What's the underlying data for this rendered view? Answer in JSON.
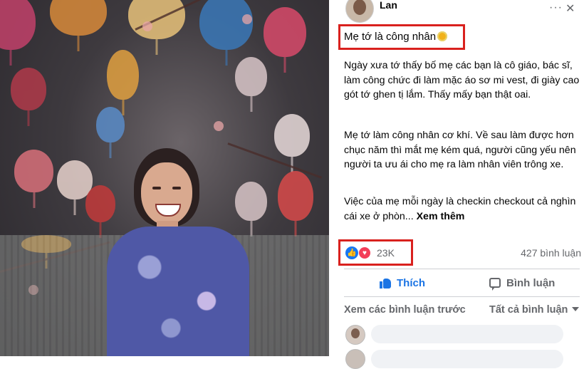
{
  "post": {
    "author": "Lan",
    "more_glyph": "···",
    "close_glyph": "✕",
    "title": "Mẹ tớ là công nhân",
    "paragraph_1": "Ngày xưa tớ thấy bố mẹ các bạn là cô giáo, bác sĩ, làm công chức đi làm mặc áo sơ mi vest, đi giày cao gót tớ ghen tị lắm. Thấy mấy bạn thật oai.",
    "paragraph_2": "Mẹ tớ làm công nhân cơ khí. Về sau làm được hơn chục năm thì mắt mẹ kém quá, người cũng yếu nên người ta ưu ái cho mẹ ra làm nhân viên trông xe.",
    "paragraph_3": "Việc của mẹ mỗi ngày là checkin checkout cả nghìn cái xe ở phòn...",
    "see_more": "Xem thêm"
  },
  "reactions": {
    "count": "23K",
    "comments": "427 bình luận"
  },
  "actions": {
    "like": "Thích",
    "comment": "Bình luận"
  },
  "comments": {
    "view_previous": "Xem các bình luận trước",
    "filter": "Tất cả bình luận"
  },
  "colors": {
    "highlight_box": "#d9211e",
    "like_blue": "#1b74e4",
    "love_red": "#f33e58",
    "muted_text": "#65676b"
  },
  "icons": [
    "more-options-icon",
    "close-icon",
    "sunflower-icon",
    "like-reaction-icon",
    "love-reaction-icon",
    "thumbs-up-icon",
    "comment-bubble-icon",
    "chevron-down-icon"
  ]
}
